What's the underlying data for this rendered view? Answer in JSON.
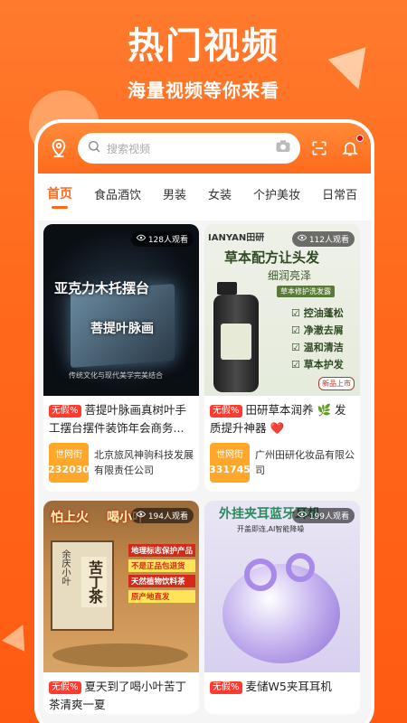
{
  "promo": {
    "title": "热门视频",
    "subtitle": "海量视频等你来看"
  },
  "header": {
    "search_placeholder": "搜索视频",
    "icons": [
      "location-icon",
      "search-icon",
      "camera-icon",
      "scan-icon",
      "bell-icon"
    ]
  },
  "tabs": [
    "首页",
    "食品酒饮",
    "男装",
    "女装",
    "个护美妆",
    "日常百"
  ],
  "cards": [
    {
      "views": "128人观看",
      "tag": "无假%",
      "title": "菩提叶脉画真树叶手工摆台摆件装饰年会商务...",
      "shop_badge": "世网街",
      "shop_id": "232030",
      "shop_name": "北京旅风神驹科技发展有限责任公司",
      "thumb_text_1": "亚克力木托摆台",
      "thumb_text_2": "菩提叶脉画",
      "thumb_text_3": "传统文化与现代美学完美结合"
    },
    {
      "views": "112人观看",
      "tag": "无假%",
      "title": "田研草本润养 🌿 发质提升神器 ❤️",
      "shop_badge": "世网街",
      "shop_id": "331745",
      "shop_name": "广州田研化妆品有限公司",
      "thumb_text_1": "IANYAN田研",
      "thumb_text_2": "草本配方让头发",
      "thumb_text_3": "细润亮泽",
      "thumb_text_4": "草本修护洗发露",
      "thumb_bullets": [
        "控油蓬松",
        "净澈去屑",
        "温和清洁",
        "草本护发"
      ],
      "thumb_text_5": "新品上市"
    },
    {
      "views": "194人观看",
      "tag": "无假%",
      "title": "夏天到了喝小叶苦丁茶清爽一夏",
      "thumb_text_1": "怕上火",
      "thumb_text_2": "喝小叶",
      "thumb_text_3": "苦丁茶",
      "thumb_text_4": "余庆小叶",
      "thumb_bullets": [
        "地理标志保护产品",
        "不是正品包退货",
        "天然植物饮料茶",
        "原产地直发"
      ]
    },
    {
      "views": "199人观看",
      "tag": "无假%",
      "title": "麦储W5夹耳耳机",
      "thumb_text_1": "外挂夹耳蓝牙耳机",
      "thumb_text_2": "开盖即连,AI智能降噪"
    }
  ],
  "colors": {
    "brand": "#ff6a1a",
    "tag": "#ff3b30",
    "shop_badge": "#ffa72a"
  }
}
